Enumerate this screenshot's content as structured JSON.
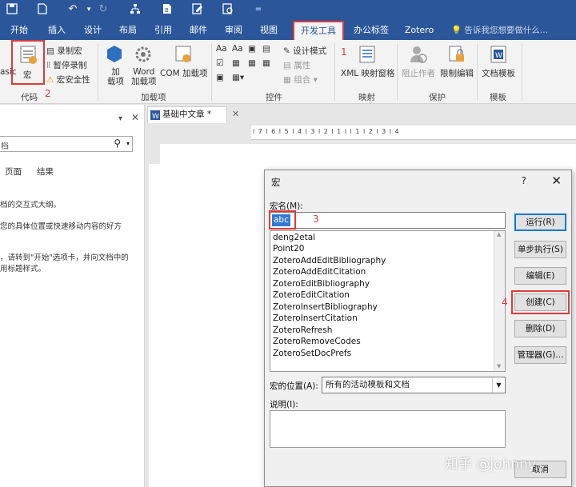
{
  "qat": {
    "icons": [
      "save-icon",
      "new-doc-icon",
      "undo-icon",
      "redo-icon",
      "tree-icon",
      "print-icon",
      "edit-doc-icon",
      "preview-icon",
      "customize-icon"
    ]
  },
  "tabs": [
    "开始",
    "插入",
    "设计",
    "布局",
    "引用",
    "邮件",
    "审阅",
    "视图",
    "开发工具",
    "办公标签",
    "Zotero"
  ],
  "active_tab": "开发工具",
  "tell_me": "告诉我您想要做什么...",
  "ribbon": {
    "code": {
      "label": "代码",
      "basic": "asic",
      "macros": "宏",
      "record": "录制宏",
      "pause": "暂停录制",
      "security": "宏安全性"
    },
    "addins": {
      "label": "加载项",
      "add": "加\n载项",
      "word": "Word\n加载项",
      "com": "COM 加载项"
    },
    "controls": {
      "label": "控件",
      "design_mode": "设计模式",
      "properties": "属性",
      "group": "组合"
    },
    "mapping": {
      "label": "映射",
      "xml": "XML 映射窗格"
    },
    "protect": {
      "label": "保护",
      "block": "阻止作者",
      "restrict": "限制编辑"
    },
    "templates": {
      "label": "模板",
      "doc_template": "文档模板"
    }
  },
  "navpane": {
    "search_placeholder": "档",
    "tabs": [
      "页面",
      "结果"
    ],
    "texts": [
      "档的交互式大纲。",
      "您的具体位置或快速移动内容的好方",
      "，请转到\"开始\"选项卡，并向文档中的",
      "用标题样式。"
    ]
  },
  "doc_tab": "基础中文章 *",
  "ruler_marks": "l 7 l 6 l 5 l 4 l 3 l 2 l 1 l   l 1 l 2 l 3 l 4",
  "dialog": {
    "title": "宏",
    "help": "?",
    "close": "✕",
    "name_label": "宏名(M):",
    "name_value": "abc",
    "macros": [
      "deng2etal",
      "Point20",
      "ZoteroAddEditBibliography",
      "ZoteroAddEditCitation",
      "ZoteroEditBibliography",
      "ZoteroEditCitation",
      "ZoteroInsertBibliography",
      "ZoteroInsertCitation",
      "ZoteroRefresh",
      "ZoteroRemoveCodes",
      "ZoteroSetDocPrefs"
    ],
    "location_label": "宏的位置(A):",
    "location_value": "所有的活动模板和文档",
    "desc_label": "说明(I):",
    "buttons": {
      "run": "运行(R)",
      "step": "单步执行(S)",
      "edit": "编辑(E)",
      "create": "创建(C)",
      "delete": "删除(D)",
      "organizer": "管理器(G)...",
      "cancel": "取消"
    }
  },
  "annotations": [
    "1",
    "2",
    "3",
    "4"
  ],
  "watermark": "知乎 @johnny",
  "colors": {
    "brand": "#2b579a",
    "highlight": "#e03a3a",
    "selection": "#3478d4"
  }
}
